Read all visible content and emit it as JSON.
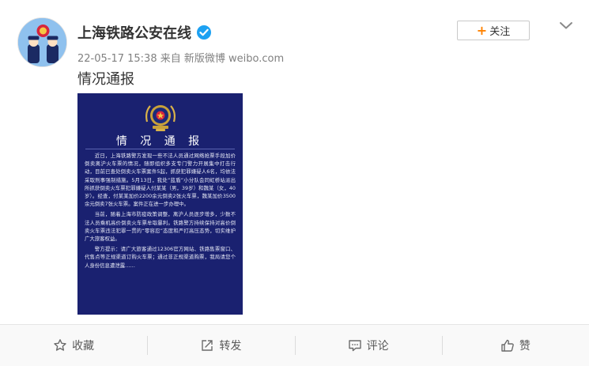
{
  "post": {
    "author": "上海铁路公安在线",
    "meta": "22-05-17 15:38 来自 新版微博 weibo.com",
    "text": "情况通报",
    "follow_label": "关注"
  },
  "notice_image": {
    "title": "情 况 通 报",
    "paragraphs": [
      "近日，上海铁路警方发现一些不法人员通过网络抢票手段加价倒卖离沪火车票的情况，随即组织多支专门警力开展集中打击行动，目前已查处倒卖火车票案件5起，抓获犯罪嫌疑人6名，均依法采取刑事强制措施。5月13日，我处“蓝盾”小分队会同虹桥站派出所抓获倒卖火车票犯罪嫌疑人付某某（男，39岁）和魏某（女，40岁）。经查，付某某加价2200余元倒卖2张火车票，魏某加价3500余元倒卖7张火车票。案件正在进一步办理中。",
      "当前，随着上海市防疫政策调整，离沪人员逐步增多，少数不法人员乘机高价倒卖火车票牟取暴利。铁路警方持续保持对高价倒卖火车票违法犯罪一贯的“零容忍”态度和严打高压态势，切实维护广大旅客权益。",
      "警方提示：请广大旅客通过12306官方网站、铁路售票窗口、代售点等正规渠道订购火车票；通过非正规渠道购票，我局请您个人身份信息遭泄露……"
    ]
  },
  "actions": [
    {
      "label": "收藏",
      "icon": "star-icon"
    },
    {
      "label": "转发",
      "icon": "share-icon"
    },
    {
      "label": "评论",
      "icon": "comment-icon"
    },
    {
      "label": "赞",
      "icon": "thumbs-up-icon"
    }
  ],
  "colors": {
    "accent": "#ff8200",
    "verified": "#1da1f2",
    "notice_bg": "#1a2170"
  }
}
